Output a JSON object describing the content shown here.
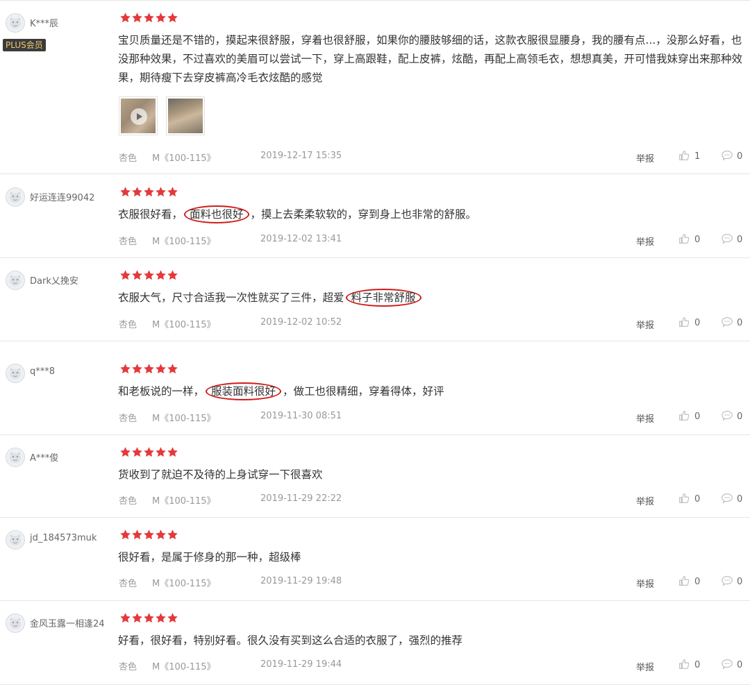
{
  "colors": {
    "star": "#e4393c",
    "highlight_circle": "#d11a1a",
    "plus_badge_bg": "#3b3b3b",
    "plus_badge_text": "#f2c86e"
  },
  "icons": {
    "avatar": "default-avatar-icon",
    "star": "star-icon",
    "like": "thumbs-up-icon",
    "comment": "comment-bubble-icon",
    "play": "play-icon"
  },
  "reviews": [
    {
      "username": "K***辰",
      "badge": "PLUS会员",
      "stars": 5,
      "comment": "宝贝质量还是不错的，摸起来很舒服，穿着也很舒服，如果你的腰肢够细的话，这款衣服很显腰身，我的腰有点...，没那么好看，也没那种效果，不过喜欢的美眉可以尝试一下，穿上高跟鞋，配上皮裤，炫酷，再配上高领毛衣，想想真美，开可惜我妹穿出来那种效果，期待瘦下去穿皮裤高冷毛衣炫酷的感觉",
      "color": "杏色",
      "size": "M《100-115》",
      "date": "2019-12-17 15:35",
      "report": "举报",
      "likes": "1",
      "comments": "0"
    },
    {
      "username": "好运连连99042",
      "stars": 5,
      "comment_pre": "衣服很好看，",
      "comment_hl": "面料也很好",
      "comment_post": "，摸上去柔柔软软的，穿到身上也非常的舒服。",
      "color": "杏色",
      "size": "M《100-115》",
      "date": "2019-12-02 13:41",
      "report": "举报",
      "likes": "0",
      "comments": "0"
    },
    {
      "username": "Dark乂挽安",
      "stars": 5,
      "comment_pre": "衣服大气，尺寸合适我一次性就买了三件，超爱",
      "comment_hl": "料子非常舒服",
      "comment_post": "",
      "color": "杏色",
      "size": "M《100-115》",
      "date": "2019-12-02 10:52",
      "report": "举报",
      "likes": "0",
      "comments": "0"
    },
    {
      "username": "q***8",
      "stars": 5,
      "comment_pre": "和老板说的一样，",
      "comment_hl": "服装面料很好",
      "comment_post": "，做工也很精细，穿着得体，好评",
      "color": "杏色",
      "size": "M《100-115》",
      "date": "2019-11-30 08:51",
      "report": "举报",
      "likes": "0",
      "comments": "0"
    },
    {
      "username": "A***俊",
      "stars": 5,
      "comment": "货收到了就迫不及待的上身试穿一下很喜欢",
      "color": "杏色",
      "size": "M《100-115》",
      "date": "2019-11-29 22:22",
      "report": "举报",
      "likes": "0",
      "comments": "0"
    },
    {
      "username": "jd_184573muk",
      "stars": 5,
      "comment": "很好看，是属于修身的那一种，超级棒",
      "color": "杏色",
      "size": "M《100-115》",
      "date": "2019-11-29 19:48",
      "report": "举报",
      "likes": "0",
      "comments": "0"
    },
    {
      "username": "金风玉露一相逢24",
      "stars": 5,
      "comment": "好看，很好看，特别好看。很久没有买到这么合适的衣服了，强烈的推荐",
      "color": "杏色",
      "size": "M《100-115》",
      "date": "2019-11-29 19:44",
      "report": "举报",
      "likes": "0",
      "comments": "0"
    }
  ]
}
